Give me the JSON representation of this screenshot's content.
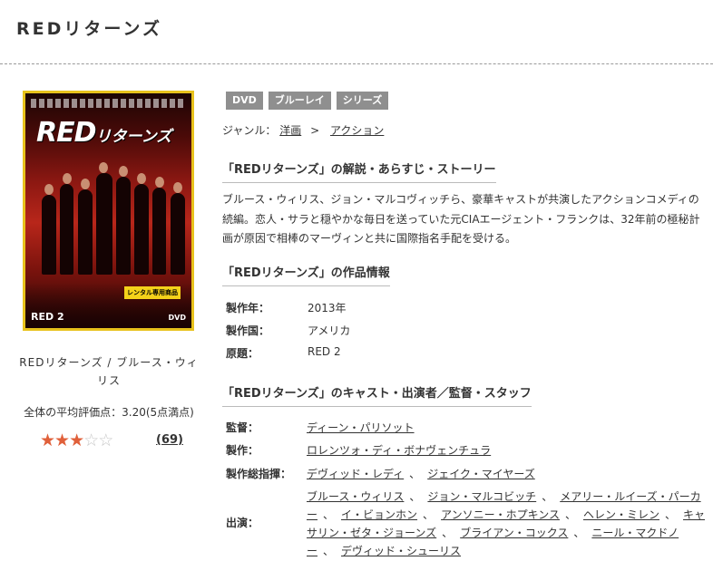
{
  "page": {
    "title": "REDリターンズ"
  },
  "cover": {
    "logo_main": "RED",
    "logo_sub": "リターンズ",
    "badge": "レンタル専用商品",
    "corner_label": "RED 2",
    "dvd_label": "DVD"
  },
  "product": {
    "caption": "REDリターンズ / ブルース・ウィリス",
    "average_rating_text": "全体の平均評価点：3.20(5点満点)",
    "rating": 3.2,
    "rating_max": 5,
    "review_count": "(69)"
  },
  "tags": [
    "DVD",
    "ブルーレイ",
    "シリーズ"
  ],
  "genre": {
    "label": "ジャンル：",
    "parent": "洋画",
    "separator": ">",
    "child": "アクション"
  },
  "sections": {
    "synopsis_heading": "「REDリターンズ」の解説・あらすじ・ストーリー",
    "info_heading": "「REDリターンズ」の作品情報",
    "staff_heading": "「REDリターンズ」のキャスト・出演者／監督・スタッフ"
  },
  "synopsis": "ブルース・ウィリス、ジョン・マルコヴィッチら、豪華キャストが共演したアクションコメディの続編。恋人・サラと穏やかな毎日を送っていた元CIAエージェント・フランクは、32年前の極秘計画が原因で相棒のマーヴィンと共に国際指名手配を受ける。",
  "info": {
    "year_label": "製作年：",
    "year": "2013年",
    "country_label": "製作国：",
    "country": "アメリカ",
    "original_label": "原題：",
    "original": "RED 2"
  },
  "staff": {
    "director_label": "監督：",
    "director": "ディーン・パリソット",
    "producer_label": "製作：",
    "producer": "ロレンツォ・ディ・ボナヴェンチュラ",
    "exec_label": "製作総指揮：",
    "exec_1": "デヴィッド・レディ",
    "exec_2": "ジェイク・マイヤーズ",
    "cast_label": "出演：",
    "cast": [
      "ブルース・ウィリス",
      "ジョン・マルコビッチ",
      "メアリー・ルイーズ・パーカー",
      "イ・ビョンホン",
      "アンソニー・ホプキンス",
      "ヘレン・ミレン",
      "キャサリン・ゼタ・ジョーンズ",
      "ブライアン・コックス",
      "ニール・マクドノー",
      "デヴィッド・シューリス"
    ],
    "comma": "、"
  },
  "colors": {
    "tag_bg": "#8f8f8f",
    "star_on": "#e0603a",
    "star_off": "#c8c8c8",
    "cover_frame": "#e8c21c"
  }
}
